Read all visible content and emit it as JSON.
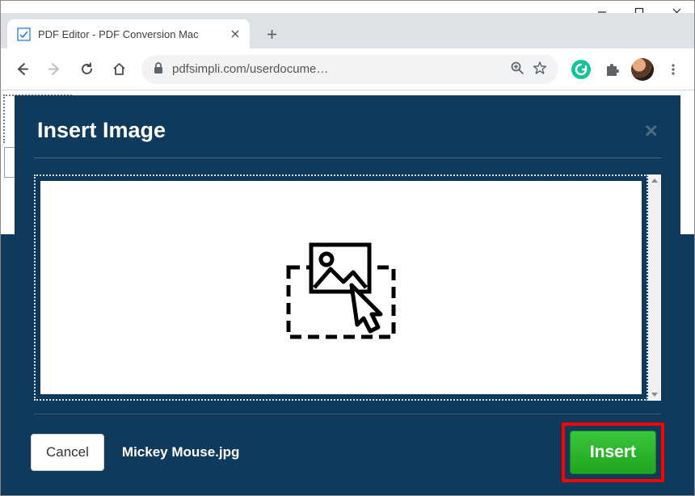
{
  "window": {
    "tab_title": "PDF Editor - PDF Conversion Mac"
  },
  "toolbar": {
    "url_display": "pdfsimpli.com/userdocume…"
  },
  "modal": {
    "title": "Insert Image",
    "filename": "Mickey Mouse.jpg",
    "cancel_label": "Cancel",
    "insert_label": "Insert"
  }
}
